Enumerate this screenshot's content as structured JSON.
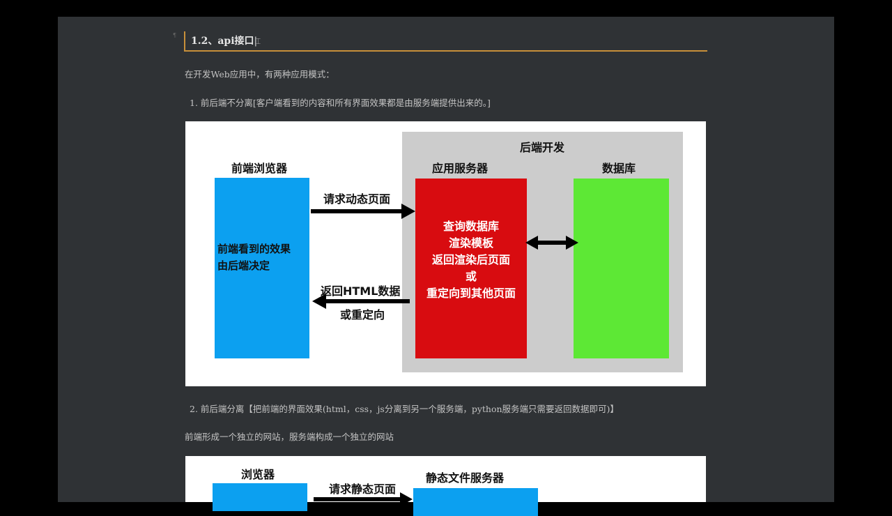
{
  "heading": "1.2、api接口",
  "para1": "在开发Web应用中，有两种应用模式：",
  "item1": "1. 前后端不分离[客户端看到的内容和所有界面效果都是由服务端提供出来的。]",
  "diagram1": {
    "backend_title": "后端开发",
    "browser_title": "前端浏览器",
    "app_server_title": "应用服务器",
    "db_title": "数据库",
    "request_label": "请求动态页面",
    "browser_text_1": "前端看到的效果",
    "browser_text_2": "由后端决定",
    "response_label_1": "返回HTML数据",
    "response_label_2": "或重定向",
    "server_lines": [
      "查询数据库",
      "渲染模板",
      "返回渲染后页面",
      "或",
      "重定向到其他页面"
    ]
  },
  "item2": "2. 前后端分离【把前端的界面效果(html，css，js分离到另一个服务端，python服务端只需要返回数据即可)】",
  "para2": "前端形成一个独立的网站，服务端构成一个独立的网站",
  "diagram2": {
    "browser_title": "浏览器",
    "request_label": "请求静态页面",
    "static_server_title": "静态文件服务器"
  },
  "colors": {
    "blue": "#0ca0f0",
    "red": "#d80c10",
    "green": "#5de835",
    "gray": "#cccccc",
    "accent": "#c8903a"
  }
}
